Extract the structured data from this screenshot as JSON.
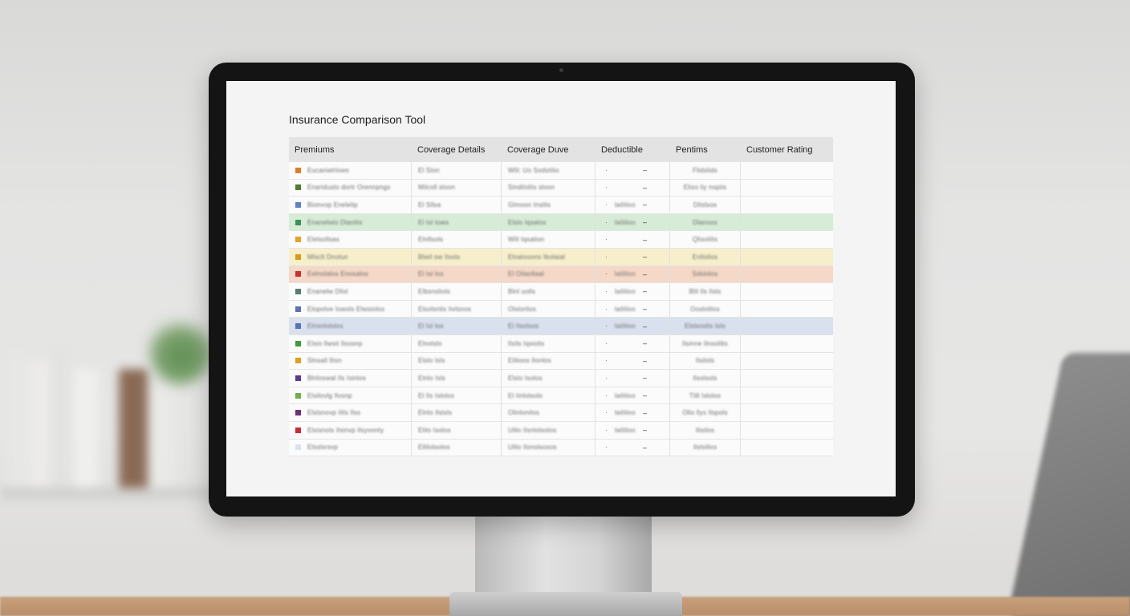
{
  "app": {
    "title": "Insurance Comparison Tool"
  },
  "table": {
    "headers": [
      "Premiums",
      "Coverage Details",
      "Coverage Duve",
      "Deductible",
      "Pentims",
      "Customer Rating"
    ],
    "rows": [
      {
        "color": "#e07b2a",
        "bg": "#fbfbfb",
        "name": "Eucanielrlows",
        "coverage": "El Slon",
        "duration": "Wlil: Uo Sodstilio",
        "deductible": "",
        "premium": "Flidslids",
        "rating": ""
      },
      {
        "color": "#4f7d2c",
        "bg": "#fbfbfb",
        "name": "Enariduslo dortr Orennpngs",
        "coverage": "Milcoll sloon",
        "duration": "Sindiloliis sloon",
        "deductible": "",
        "premium": "Eliso liy nopiis",
        "rating": ""
      },
      {
        "color": "#5f84c4",
        "bg": "#fbfbfb",
        "name": "Bionvop Enelelip",
        "coverage": "El Sllsa",
        "duration": "Glmoon Insilis",
        "deductible": "laililioo",
        "premium": "Dlislsos",
        "rating": ""
      },
      {
        "color": "#3d8f5a",
        "bg": "#d6ecd6",
        "name": "Enanelwlo Dlanilis",
        "coverage": "El Isl tows",
        "duration": "Elslo Iqsalos",
        "deductible": "laililioo",
        "premium": "Dlanoos",
        "rating": ""
      },
      {
        "color": "#e5a12b",
        "bg": "#fbfbfb",
        "name": "Elelsollsas",
        "coverage": "Elnllsols",
        "duration": "Wlil Iqsalion",
        "deductible": "",
        "premium": "Qlisolilis",
        "rating": ""
      },
      {
        "color": "#d89a1a",
        "bg": "#f7efcc",
        "name": "Mlsclt Dnolun",
        "coverage": "Blwil ow Ilsols",
        "duration": "Elnalooons Ibolaial",
        "deductible": "",
        "premium": "Enllolios",
        "rating": ""
      },
      {
        "color": "#c9302c",
        "bg": "#f5d8c7",
        "name": "Eelnolalos Enosalos",
        "coverage": "El Isl los",
        "duration": "El Oilanllaal",
        "deductible": "laililioo",
        "premium": "Sdslolos",
        "rating": ""
      },
      {
        "color": "#557f70",
        "bg": "#fbfbfb",
        "name": "Enanelw Dlisl",
        "coverage": "Elbsnsliols",
        "duration": "Blnl uolls",
        "deductible": "laililioo",
        "premium": "Blil Ils Ilsls",
        "rating": ""
      },
      {
        "color": "#5d74a8",
        "bg": "#fbfbfb",
        "name": "Elopolve Iowols Elwsiolos",
        "coverage": "Elsolsnlis Iivlsnos",
        "duration": "Olslorlios",
        "deductible": "laililioo",
        "premium": "Ooslolilos",
        "rating": ""
      },
      {
        "color": "#5474b8",
        "bg": "#d9e1ee",
        "name": "Elnsnlolslos",
        "coverage": "El Isl los",
        "duration": "El Ilsolsos",
        "deductible": "laililioo",
        "premium": "Elslsnolis Islo",
        "rating": ""
      },
      {
        "color": "#3f9a3a",
        "bg": "#fbfbfb",
        "name": "Elsio llwsit Ilsosnp",
        "coverage": "Elnolslo",
        "duration": "Ilsils Iqsiolis",
        "deductible": "",
        "premium": "Ilsinne Ilnsolilis",
        "rating": ""
      },
      {
        "color": "#e3a01f",
        "bg": "#fbfbfb",
        "name": "Slnsall Ilisn",
        "coverage": "Elslo Isls",
        "duration": "Elilioos Ilonlos",
        "deductible": "",
        "premium": "Ilsilols",
        "rating": ""
      },
      {
        "color": "#5b3a8c",
        "bg": "#fbfbfb",
        "name": "Blnloswal Ils Isinlos",
        "coverage": "Elnlo Isls",
        "duration": "Elslo Isolos",
        "deductible": "",
        "premium": "Ilsolsols",
        "rating": ""
      },
      {
        "color": "#6fae4a",
        "bg": "#fbfbfb",
        "name": "Elsilovlg Ilvsnp",
        "coverage": "El Ils Islolos",
        "duration": "El Iinlolsolo",
        "deductible": "laililioo",
        "premium": "Tlill Islolos",
        "rating": ""
      },
      {
        "color": "#6a3373",
        "bg": "#fbfbfb",
        "name": "Elslsnovp Ilils Ilss",
        "coverage": "Elnlo Ilslsls",
        "duration": "Olinlonilos",
        "deductible": "laililioo",
        "premium": "Ollo llys Ilspols",
        "rating": ""
      },
      {
        "color": "#c62d34",
        "bg": "#fbfbfb",
        "name": "Elsisnols Ilsinvp Ilsyvonty",
        "coverage": "Elilo Isolos",
        "duration": "Ulilo Ilsnlolsolos",
        "deductible": "laililioo",
        "premium": "Ilisilos",
        "rating": ""
      },
      {
        "color": "#d9e2ef",
        "bg": "#fbfbfb",
        "name": "Elsslsrsvp",
        "coverage": "Ellilolsolos",
        "duration": "Ulilo Ilsnolsosos",
        "deductible": "",
        "premium": "Ilslsilios",
        "rating": ""
      }
    ]
  }
}
